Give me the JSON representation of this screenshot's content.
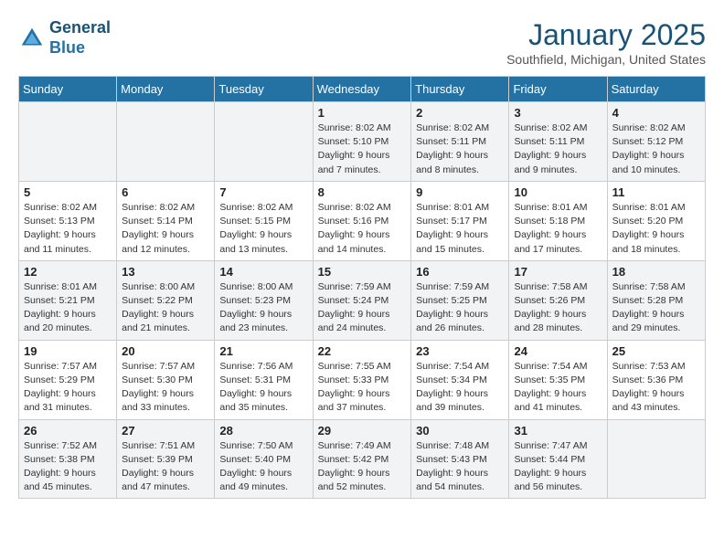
{
  "header": {
    "logo_line1": "General",
    "logo_line2": "Blue",
    "month": "January 2025",
    "location": "Southfield, Michigan, United States"
  },
  "weekdays": [
    "Sunday",
    "Monday",
    "Tuesday",
    "Wednesday",
    "Thursday",
    "Friday",
    "Saturday"
  ],
  "weeks": [
    [
      {
        "day": "",
        "info": ""
      },
      {
        "day": "",
        "info": ""
      },
      {
        "day": "",
        "info": ""
      },
      {
        "day": "1",
        "info": "Sunrise: 8:02 AM\nSunset: 5:10 PM\nDaylight: 9 hours and 7 minutes."
      },
      {
        "day": "2",
        "info": "Sunrise: 8:02 AM\nSunset: 5:11 PM\nDaylight: 9 hours and 8 minutes."
      },
      {
        "day": "3",
        "info": "Sunrise: 8:02 AM\nSunset: 5:11 PM\nDaylight: 9 hours and 9 minutes."
      },
      {
        "day": "4",
        "info": "Sunrise: 8:02 AM\nSunset: 5:12 PM\nDaylight: 9 hours and 10 minutes."
      }
    ],
    [
      {
        "day": "5",
        "info": "Sunrise: 8:02 AM\nSunset: 5:13 PM\nDaylight: 9 hours and 11 minutes."
      },
      {
        "day": "6",
        "info": "Sunrise: 8:02 AM\nSunset: 5:14 PM\nDaylight: 9 hours and 12 minutes."
      },
      {
        "day": "7",
        "info": "Sunrise: 8:02 AM\nSunset: 5:15 PM\nDaylight: 9 hours and 13 minutes."
      },
      {
        "day": "8",
        "info": "Sunrise: 8:02 AM\nSunset: 5:16 PM\nDaylight: 9 hours and 14 minutes."
      },
      {
        "day": "9",
        "info": "Sunrise: 8:01 AM\nSunset: 5:17 PM\nDaylight: 9 hours and 15 minutes."
      },
      {
        "day": "10",
        "info": "Sunrise: 8:01 AM\nSunset: 5:18 PM\nDaylight: 9 hours and 17 minutes."
      },
      {
        "day": "11",
        "info": "Sunrise: 8:01 AM\nSunset: 5:20 PM\nDaylight: 9 hours and 18 minutes."
      }
    ],
    [
      {
        "day": "12",
        "info": "Sunrise: 8:01 AM\nSunset: 5:21 PM\nDaylight: 9 hours and 20 minutes."
      },
      {
        "day": "13",
        "info": "Sunrise: 8:00 AM\nSunset: 5:22 PM\nDaylight: 9 hours and 21 minutes."
      },
      {
        "day": "14",
        "info": "Sunrise: 8:00 AM\nSunset: 5:23 PM\nDaylight: 9 hours and 23 minutes."
      },
      {
        "day": "15",
        "info": "Sunrise: 7:59 AM\nSunset: 5:24 PM\nDaylight: 9 hours and 24 minutes."
      },
      {
        "day": "16",
        "info": "Sunrise: 7:59 AM\nSunset: 5:25 PM\nDaylight: 9 hours and 26 minutes."
      },
      {
        "day": "17",
        "info": "Sunrise: 7:58 AM\nSunset: 5:26 PM\nDaylight: 9 hours and 28 minutes."
      },
      {
        "day": "18",
        "info": "Sunrise: 7:58 AM\nSunset: 5:28 PM\nDaylight: 9 hours and 29 minutes."
      }
    ],
    [
      {
        "day": "19",
        "info": "Sunrise: 7:57 AM\nSunset: 5:29 PM\nDaylight: 9 hours and 31 minutes."
      },
      {
        "day": "20",
        "info": "Sunrise: 7:57 AM\nSunset: 5:30 PM\nDaylight: 9 hours and 33 minutes."
      },
      {
        "day": "21",
        "info": "Sunrise: 7:56 AM\nSunset: 5:31 PM\nDaylight: 9 hours and 35 minutes."
      },
      {
        "day": "22",
        "info": "Sunrise: 7:55 AM\nSunset: 5:33 PM\nDaylight: 9 hours and 37 minutes."
      },
      {
        "day": "23",
        "info": "Sunrise: 7:54 AM\nSunset: 5:34 PM\nDaylight: 9 hours and 39 minutes."
      },
      {
        "day": "24",
        "info": "Sunrise: 7:54 AM\nSunset: 5:35 PM\nDaylight: 9 hours and 41 minutes."
      },
      {
        "day": "25",
        "info": "Sunrise: 7:53 AM\nSunset: 5:36 PM\nDaylight: 9 hours and 43 minutes."
      }
    ],
    [
      {
        "day": "26",
        "info": "Sunrise: 7:52 AM\nSunset: 5:38 PM\nDaylight: 9 hours and 45 minutes."
      },
      {
        "day": "27",
        "info": "Sunrise: 7:51 AM\nSunset: 5:39 PM\nDaylight: 9 hours and 47 minutes."
      },
      {
        "day": "28",
        "info": "Sunrise: 7:50 AM\nSunset: 5:40 PM\nDaylight: 9 hours and 49 minutes."
      },
      {
        "day": "29",
        "info": "Sunrise: 7:49 AM\nSunset: 5:42 PM\nDaylight: 9 hours and 52 minutes."
      },
      {
        "day": "30",
        "info": "Sunrise: 7:48 AM\nSunset: 5:43 PM\nDaylight: 9 hours and 54 minutes."
      },
      {
        "day": "31",
        "info": "Sunrise: 7:47 AM\nSunset: 5:44 PM\nDaylight: 9 hours and 56 minutes."
      },
      {
        "day": "",
        "info": ""
      }
    ]
  ]
}
